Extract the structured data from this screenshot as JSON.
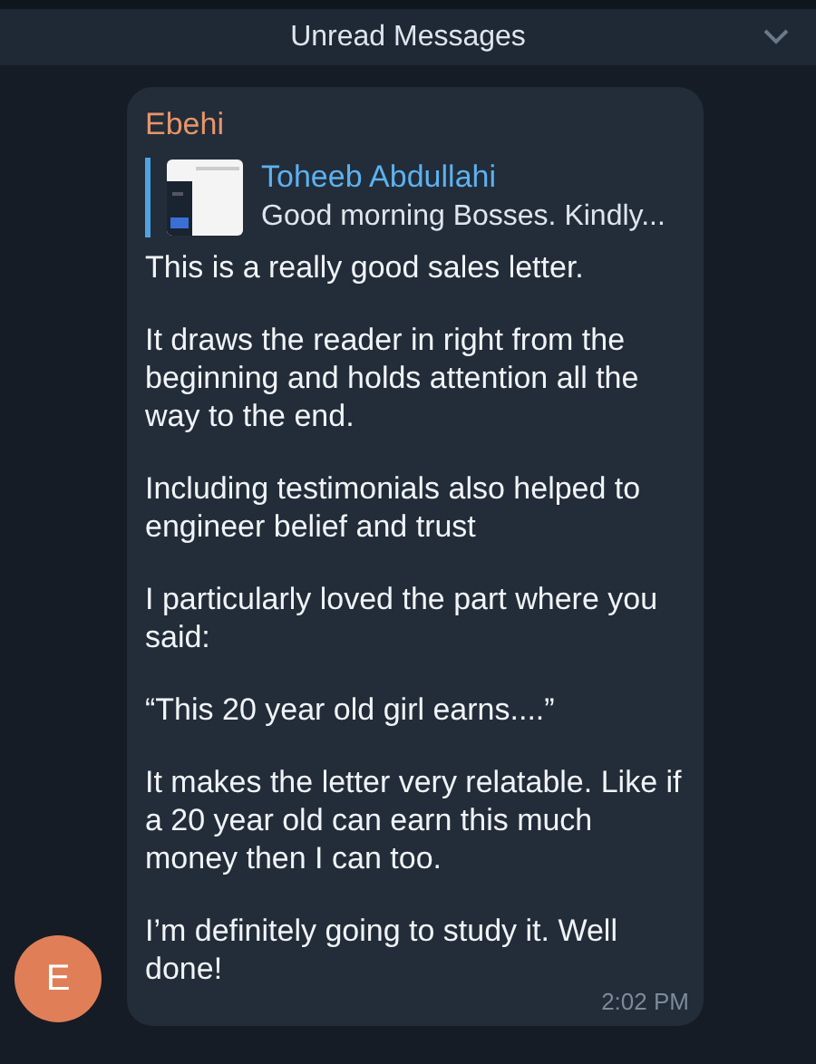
{
  "header": {
    "title": "Unread Messages"
  },
  "message": {
    "sender": "Ebehi",
    "avatar": {
      "letter": "E",
      "color": "#e07f57"
    },
    "reply": {
      "author": "Toheeb Abdullahi",
      "snippet": "Good morning Bosses.  Kindly..."
    },
    "paragraphs": [
      "This is a really good sales letter.",
      "It draws the reader in right from the beginning and holds attention all the way to the end.",
      "Including testimonials also helped to engineer belief and trust",
      "I particularly loved the part where you said:",
      "“This 20 year old girl earns....”",
      "It makes the letter very relatable. Like if a 20 year old can earn this much money then I can too.",
      "I’m definitely going to study it. Well done!"
    ],
    "time": "2:02 PM"
  }
}
